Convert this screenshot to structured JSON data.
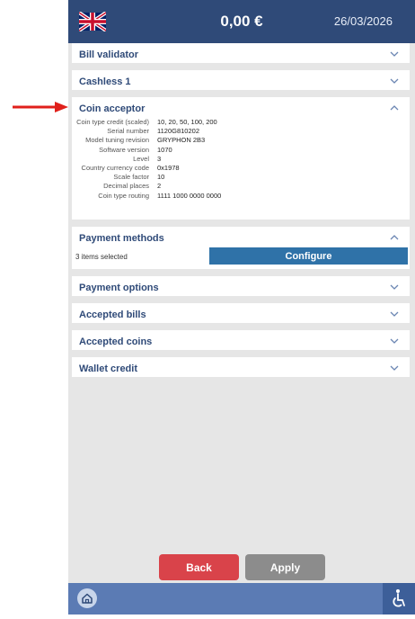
{
  "header": {
    "amount": "0,00 €",
    "date": "26/03/2026",
    "flag_icon": "uk-flag-icon"
  },
  "panels": [
    {
      "title": "Bill validator",
      "expanded": false
    },
    {
      "title": "Cashless 1",
      "expanded": false
    },
    {
      "title": "Coin acceptor",
      "expanded": true
    },
    {
      "title": "Payment methods",
      "expanded": true
    },
    {
      "title": "Payment options",
      "expanded": false
    },
    {
      "title": "Accepted bills",
      "expanded": false
    },
    {
      "title": "Accepted coins",
      "expanded": false
    },
    {
      "title": "Wallet credit",
      "expanded": false
    }
  ],
  "coin_acceptor": {
    "rows": [
      {
        "label": "Coin type credit (scaled)",
        "value": "10, 20, 50, 100, 200"
      },
      {
        "label": "Serial number",
        "value": "1120G810202"
      },
      {
        "label": "Model tuning revision",
        "value": "GRYPHON 2B3"
      },
      {
        "label": "Software version",
        "value": "1070"
      },
      {
        "label": "Level",
        "value": "3"
      },
      {
        "label": "Country currency code",
        "value": "0x1978"
      },
      {
        "label": "Scale factor",
        "value": "10"
      },
      {
        "label": "Decimal places",
        "value": "2"
      },
      {
        "label": "Coin type routing",
        "value": "1111 1000 0000 0000"
      }
    ]
  },
  "payment_methods": {
    "selected_text": "3 items selected",
    "configure_label": "Configure"
  },
  "footer": {
    "back_label": "Back",
    "apply_label": "Apply"
  },
  "icons": {
    "home": "home-icon",
    "accessibility": "accessibility-icon",
    "arrow": "red-arrow-icon"
  },
  "colors": {
    "header": "#2f4a78",
    "accent": "#2f72a8",
    "back": "#d9434a",
    "apply": "#8c8c8c",
    "arrow": "#e0201b"
  }
}
